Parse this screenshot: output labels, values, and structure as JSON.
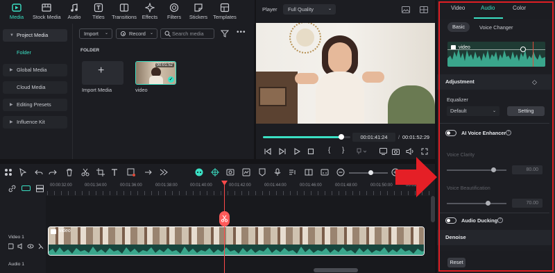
{
  "toolbar": {
    "items": [
      {
        "label": "Media",
        "icon": "media-icon",
        "active": true
      },
      {
        "label": "Stock Media",
        "icon": "stock-media-icon"
      },
      {
        "label": "Audio",
        "icon": "audio-icon"
      },
      {
        "label": "Titles",
        "icon": "titles-icon"
      },
      {
        "label": "Transitions",
        "icon": "transitions-icon"
      },
      {
        "label": "Effects",
        "icon": "effects-icon"
      },
      {
        "label": "Filters",
        "icon": "filters-icon"
      },
      {
        "label": "Stickers",
        "icon": "stickers-icon"
      },
      {
        "label": "Templates",
        "icon": "templates-icon"
      }
    ]
  },
  "sidebar": {
    "items": [
      {
        "label": "Project Media",
        "expanded": true
      },
      {
        "label": "Folder",
        "selected": true
      },
      {
        "label": "Global Media"
      },
      {
        "label": "Cloud Media"
      },
      {
        "label": "Editing Presets"
      },
      {
        "label": "Influence Kit"
      }
    ]
  },
  "media": {
    "import_label": "Import",
    "record_label": "Record",
    "search_placeholder": "Search media",
    "folder_title": "FOLDER",
    "import_media_label": "Import Media",
    "clip_name": "video",
    "clip_duration": "00:01:52"
  },
  "player": {
    "label": "Player",
    "quality": "Full Quality",
    "current_time": "00:01:41:24",
    "total_time": "00:01:52:29",
    "progress": 0.9
  },
  "right_panel": {
    "tabs": [
      "Video",
      "Audio",
      "Color"
    ],
    "active_tab": "Audio",
    "subtabs": [
      "Basic",
      "Voice Changer"
    ],
    "track_name": "video",
    "adjustment_label": "Adjustment",
    "equalizer_label": "Equalizer",
    "equalizer_value": "Default",
    "setting_label": "Setting",
    "ai_voice_label": "AI Voice Enhancer",
    "voice_clarity_label": "Voice Clarity",
    "voice_clarity_value": "80.00",
    "voice_beautification_label": "Voice Beautification",
    "voice_beautification_value": "70.00",
    "audio_ducking_label": "Audio Ducking",
    "denoise_label": "Denoise",
    "reset_label": "Reset",
    "accent": "#3be0c4",
    "highlight": "#e01e24"
  },
  "timeline": {
    "ticks": [
      "00:00:32:00",
      "00:01:34:00",
      "00:01:36:00",
      "00:01:38:00",
      "00:01:40:00",
      "00:01:42:00",
      "00:01:44:00",
      "00:01:46:00",
      "00:01:48:00",
      "00:01:50:00",
      "00:01:52:00"
    ],
    "video_track_label": "Video 1",
    "audio_track_label": "Audio 1",
    "clip_label": "video"
  }
}
